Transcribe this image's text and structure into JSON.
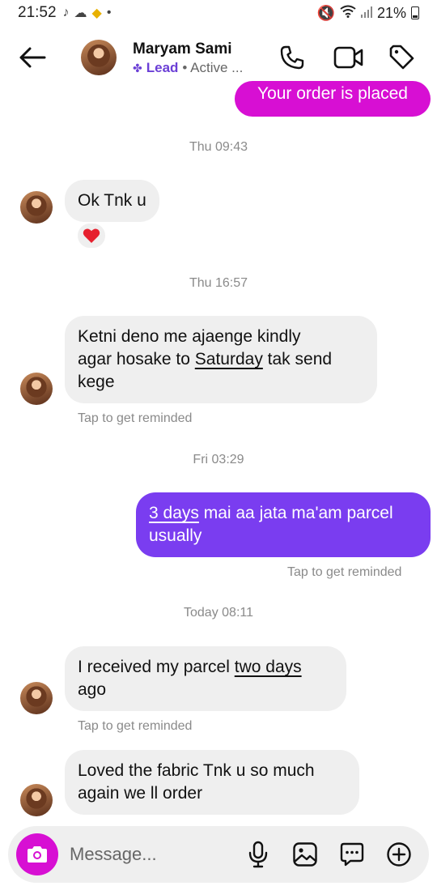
{
  "status_bar": {
    "time": "21:52",
    "battery": "21%"
  },
  "header": {
    "name": "Maryam Sami",
    "lead_label": "Lead",
    "active_label": "• Active ..."
  },
  "messages": {
    "m0_text": "Your order is placed",
    "ts1": "Thu 09:43",
    "m1_text": "Ok Tnk u",
    "m1_reaction": "❤️",
    "ts2": "Thu 16:57",
    "m2_line1": "Ketni deno me ajaenge kindly",
    "m2_line2_a": "agar hosake to ",
    "m2_line2_u": "Saturday",
    "m2_line2_b": " tak send",
    "m2_line3": "kege",
    "m2_hint": "Tap to get reminded",
    "ts3": "Fri 03:29",
    "m3_line1_u": "3 days",
    "m3_line1_b": " mai aa jata ma'am parcel",
    "m3_line2": "usually",
    "m3_hint": "Tap to get reminded",
    "ts4": "Today 08:11",
    "m4_line1_a": "I received my parcel ",
    "m4_line1_u": "two days",
    "m4_line2": "ago",
    "m4_hint": "Tap to get reminded",
    "m5_line1": "Loved the fabric Tnk u so much",
    "m5_line2": "again we ll order"
  },
  "composer": {
    "placeholder": "Message..."
  },
  "icons": {
    "back": "arrow-left-icon",
    "call": "phone-icon",
    "video": "video-camera-icon",
    "tag": "tag-icon",
    "camera": "camera-icon",
    "mic": "microphone-icon",
    "gallery": "image-icon",
    "sticker": "chat-bubble-icon",
    "more": "plus-circle-icon"
  },
  "colors": {
    "pink_bubble": "#d70fd3",
    "purple_bubble": "#7a3df0",
    "incoming_bubble": "#efefef",
    "lead": "#6b3fd6"
  }
}
